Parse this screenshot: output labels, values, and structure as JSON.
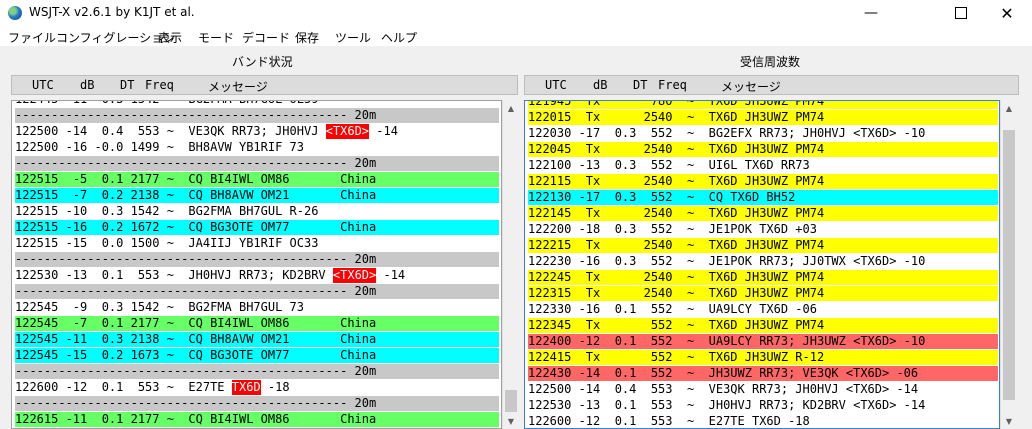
{
  "window": {
    "title": "WSJT-X   v2.6.1   by K1JT et al.",
    "minimize_icon": "minimize-icon",
    "maximize_icon": "maximize-icon",
    "close_icon": "close-icon"
  },
  "menu": [
    "ファイル",
    "コンフィグレーション",
    "表示",
    "モード",
    "デコード",
    "保存",
    "ツール",
    "ヘルプ"
  ],
  "colors": {
    "green": "#66ff66",
    "cyan": "#00ffff",
    "yellow": "#ffff00",
    "red": "#ff6666",
    "separator": "#c8c8c8",
    "tag_red": "#ff0000"
  },
  "band_activity": {
    "title": "バンド状況",
    "headers": {
      "utc": "UTC",
      "db": "dB",
      "dt": "DT",
      "freq": "Freq",
      "message": "メッセージ"
    },
    "rows": [
      {
        "text": "122445 -11  0.3 1542 ~  BG2FMA BH7GUL OL59",
        "bg": "white"
      },
      {
        "text": "---------------------------------------------- 20m",
        "bg": "separator"
      },
      {
        "pre": "122500 -14  0.4  553 ~  VE3QK RR73; JH0HVJ ",
        "tag": "<TX6D>",
        "post": " -14",
        "bg": "white"
      },
      {
        "text": "122500 -16 -0.0 1499 ~  BH8AVW YB1RIF 73",
        "bg": "white"
      },
      {
        "text": "---------------------------------------------- 20m",
        "bg": "separator"
      },
      {
        "text": "122515  -5  0.1 2177 ~  CQ BI4IWL OM86       China",
        "bg": "green"
      },
      {
        "text": "122515  -7  0.2 2138 ~  CQ BH8AVW OM21       China",
        "bg": "cyan"
      },
      {
        "text": "122515 -10  0.3 1542 ~  BG2FMA BH7GUL R-26",
        "bg": "white"
      },
      {
        "text": "122515 -16  0.2 1672 ~  CQ BG3OTE OM77       China",
        "bg": "cyan"
      },
      {
        "text": "122515 -15  0.0 1500 ~  JA4IIJ YB1RIF OC33",
        "bg": "white"
      },
      {
        "text": "---------------------------------------------- 20m",
        "bg": "separator"
      },
      {
        "pre": "122530 -13  0.1  553 ~  JH0HVJ RR73; KD2BRV ",
        "tag": "<TX6D>",
        "post": " -14",
        "bg": "white"
      },
      {
        "text": "---------------------------------------------- 20m",
        "bg": "separator"
      },
      {
        "text": "122545  -9  0.3 1542 ~  BG2FMA BH7GUL 73",
        "bg": "white"
      },
      {
        "text": "122545  -7  0.1 2177 ~  CQ BI4IWL OM86       China",
        "bg": "green"
      },
      {
        "text": "122545 -11  0.3 2138 ~  CQ BH8AVW OM21       China",
        "bg": "cyan"
      },
      {
        "text": "122545 -15  0.2 1673 ~  CQ BG3OTE OM77       China",
        "bg": "cyan"
      },
      {
        "text": "---------------------------------------------- 20m",
        "bg": "separator"
      },
      {
        "pre": "122600 -12  0.1  553 ~  E27TE ",
        "tag": "TX6D",
        "post": " -18",
        "bg": "white"
      },
      {
        "text": "---------------------------------------------- 20m",
        "bg": "separator"
      },
      {
        "text": "122615 -11  0.1 2177 ~  CQ BI4IWL OM86       China",
        "bg": "green"
      }
    ]
  },
  "rx_frequency": {
    "title": "受信周波数",
    "headers": {
      "utc": "UTC",
      "db": "dB",
      "dt": "DT",
      "freq": "Freq",
      "message": "メッセージ"
    },
    "rows": [
      {
        "text": "121945  Tx       780  ~  TX6D JH3UWZ PM74",
        "bg": "yellow"
      },
      {
        "text": "122015  Tx      2540  ~  TX6D JH3UWZ PM74",
        "bg": "yellow"
      },
      {
        "text": "122030 -17  0.3  552  ~  BG2EFX RR73; JH0HVJ <TX6D> -10",
        "bg": "white"
      },
      {
        "text": "122045  Tx      2540  ~  TX6D JH3UWZ PM74",
        "bg": "yellow"
      },
      {
        "text": "122100 -13  0.3  552  ~  UI6L TX6D RR73",
        "bg": "white"
      },
      {
        "text": "122115  Tx      2540  ~  TX6D JH3UWZ PM74",
        "bg": "yellow"
      },
      {
        "text": "122130 -17  0.3  552  ~  CQ TX6D BH52",
        "bg": "cyan"
      },
      {
        "text": "122145  Tx      2540  ~  TX6D JH3UWZ PM74",
        "bg": "yellow"
      },
      {
        "text": "122200 -18  0.3  552  ~  JE1POK TX6D +03",
        "bg": "white"
      },
      {
        "text": "122215  Tx      2540  ~  TX6D JH3UWZ PM74",
        "bg": "yellow"
      },
      {
        "text": "122230 -16  0.3  552  ~  JE1POK RR73; JJ0TWX <TX6D> -10",
        "bg": "white"
      },
      {
        "text": "122245  Tx      2540  ~  TX6D JH3UWZ PM74",
        "bg": "yellow"
      },
      {
        "text": "122315  Tx      2540  ~  TX6D JH3UWZ PM74",
        "bg": "yellow"
      },
      {
        "text": "122330 -16  0.1  552  ~  UA9LCY TX6D -06",
        "bg": "white"
      },
      {
        "text": "122345  Tx       552  ~  TX6D JH3UWZ PM74",
        "bg": "yellow"
      },
      {
        "text": "122400 -12  0.1  552  ~  UA9LCY RR73; JH3UWZ <TX6D> -10",
        "bg": "red"
      },
      {
        "text": "122415  Tx       552  ~  TX6D JH3UWZ R-12",
        "bg": "yellow"
      },
      {
        "text": "122430 -14  0.1  552  ~  JH3UWZ RR73; VE3QK <TX6D> -06",
        "bg": "red"
      },
      {
        "text": "122500 -14  0.4  553  ~  VE3QK RR73; JH0HVJ <TX6D> -14",
        "bg": "white"
      },
      {
        "text": "122530 -13  0.1  553  ~  JH0HVJ RR73; KD2BRV <TX6D> -14",
        "bg": "white"
      },
      {
        "text": "122600 -12  0.1  553  ~  E27TE TX6D -18",
        "bg": "white"
      }
    ]
  }
}
